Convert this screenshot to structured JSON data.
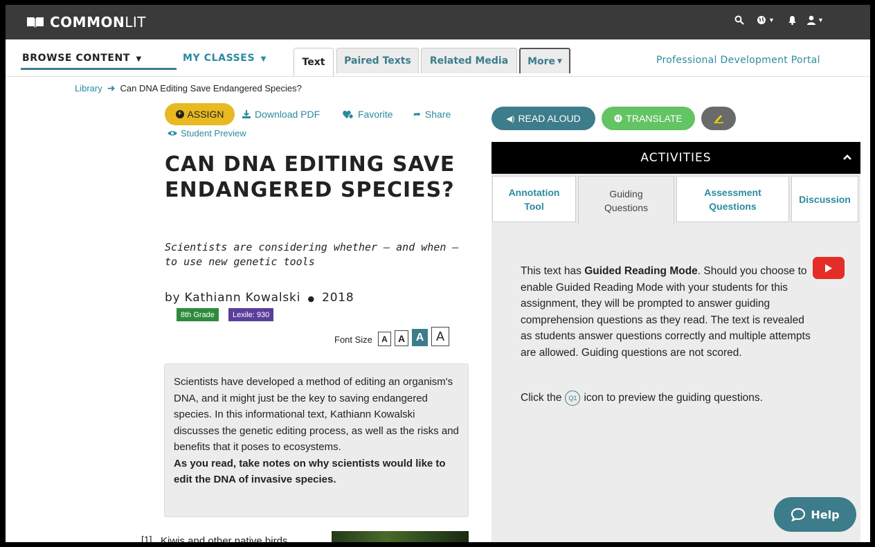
{
  "brand": {
    "logo_bold": "COMMON",
    "logo_light": "LIT"
  },
  "topbar": {
    "icons": [
      "search-icon",
      "globe-icon",
      "bell-icon",
      "user-icon"
    ]
  },
  "nav": {
    "browse_label": "BROWSE CONTENT",
    "classes_label": "MY CLASSES",
    "tabs": [
      {
        "label": "Text"
      },
      {
        "label": "Paired Texts"
      },
      {
        "label": "Related Media"
      },
      {
        "label": "More"
      }
    ],
    "portal_label": "Professional Development Portal"
  },
  "breadcrumb": {
    "library": "Library",
    "current": "Can DNA Editing Save Endangered Species?"
  },
  "actions": {
    "assign": "ASSIGN",
    "download": "Download PDF",
    "favorite": "Favorite",
    "share": "Share",
    "preview": "Student Preview"
  },
  "text": {
    "title": "CAN DNA EDITING SAVE ENDANGERED SPECIES?",
    "subtitle": "Scientists are considering whether — and when — to use new genetic tools",
    "author": "by Kathiann Kowalski",
    "year": "2018",
    "grade": "8th Grade",
    "lexile": "Lexile: 930",
    "font_size_label": "Font Size",
    "font_size_options": [
      "A",
      "A",
      "A",
      "A"
    ],
    "summary": "Scientists have developed a method of editing an organism's DNA, and it might just be the key to saving endangered species. In this informational text, Kathiann Kowalski discusses the genetic editing process, as well as the risks and benefits that it poses to ecosystems.",
    "summary_prompt": "As you read, take notes on why scientists would like to edit the DNA of invasive species.",
    "para_number": "[1]",
    "para_start": "Kiwis and other native birds"
  },
  "tools": {
    "read_aloud": "READ ALOUD",
    "translate": "TRANSLATE"
  },
  "activities": {
    "header": "ACTIVITIES",
    "tabs": [
      {
        "label": "Annotation Tool"
      },
      {
        "label": "Guiding Questions"
      },
      {
        "label": "Assessment Questions"
      },
      {
        "label": "Discussion"
      }
    ],
    "guided_intro": "This text has ",
    "guided_bold": "Guided Reading Mode",
    "guided_rest": ". Should you choose to enable Guided Reading Mode with your students for this assignment, they will be prompted to answer guiding comprehension questions as they read. The text is revealed as students answer questions correctly and multiple attempts are allowed. Guiding questions are not scored.",
    "click_the": "Click the",
    "q1_label": "Q1",
    "preview_text": "icon to preview the guiding questions."
  },
  "help": {
    "label": "Help"
  },
  "colors": {
    "teal": "#3d7c8a",
    "link": "#2a8aa0",
    "assign_yellow": "#e8b920",
    "translate_green": "#62c462",
    "grade_green": "#2e8b3d",
    "lexile_purple": "#5a3e9b",
    "youtube_red": "#e52d27"
  }
}
